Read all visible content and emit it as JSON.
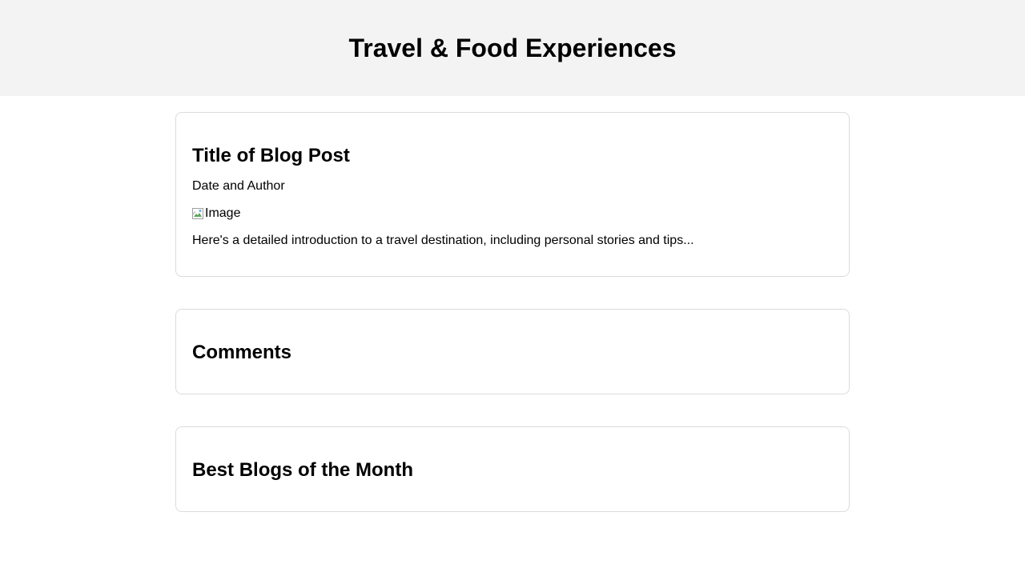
{
  "header": {
    "title": "Travel & Food Experiences"
  },
  "post": {
    "title": "Title of Blog Post",
    "meta": "Date and Author",
    "image_alt": "Image",
    "intro": "Here's a detailed introduction to a travel destination, including personal stories and tips..."
  },
  "comments": {
    "heading": "Comments"
  },
  "best_blogs": {
    "heading": "Best Blogs of the Month"
  },
  "icons": {
    "broken_image": "broken-image-icon"
  },
  "colors": {
    "header_background": "#f3f3f3",
    "card_border": "#dcdcdc"
  }
}
